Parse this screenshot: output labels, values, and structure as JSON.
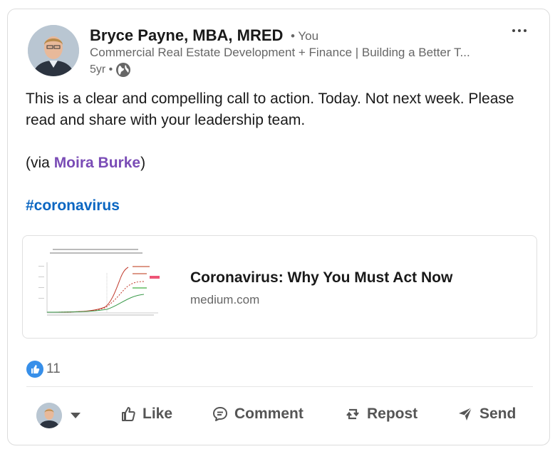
{
  "post": {
    "author_name": "Bryce Payne, MBA, MRED",
    "author_you": "• You",
    "author_headline": "Commercial Real Estate Development + Finance | Building a Better T...",
    "time": "5yr •",
    "line1": "This is a clear and compelling call to action. Today. Not next week. Please read and share with your leadership team.",
    "via_prefix": "(via ",
    "via_name": "Moira Burke",
    "via_suffix": ")",
    "hashtag": "#coronavirus"
  },
  "link_preview": {
    "title": "Coronavirus: Why You Must Act Now",
    "source": "medium.com"
  },
  "social": {
    "reaction_count": "11"
  },
  "actions": {
    "like": "Like",
    "comment": "Comment",
    "repost": "Repost",
    "send": "Send"
  },
  "icons": [
    "globe-icon",
    "more-icon",
    "like-reaction-icon",
    "like-icon",
    "comment-icon",
    "repost-icon",
    "send-icon",
    "caret-down-icon"
  ],
  "colors": {
    "link_blue": "#0a66c2",
    "mention_purple": "#7a4cb6",
    "reaction_blue": "#378fe9"
  }
}
